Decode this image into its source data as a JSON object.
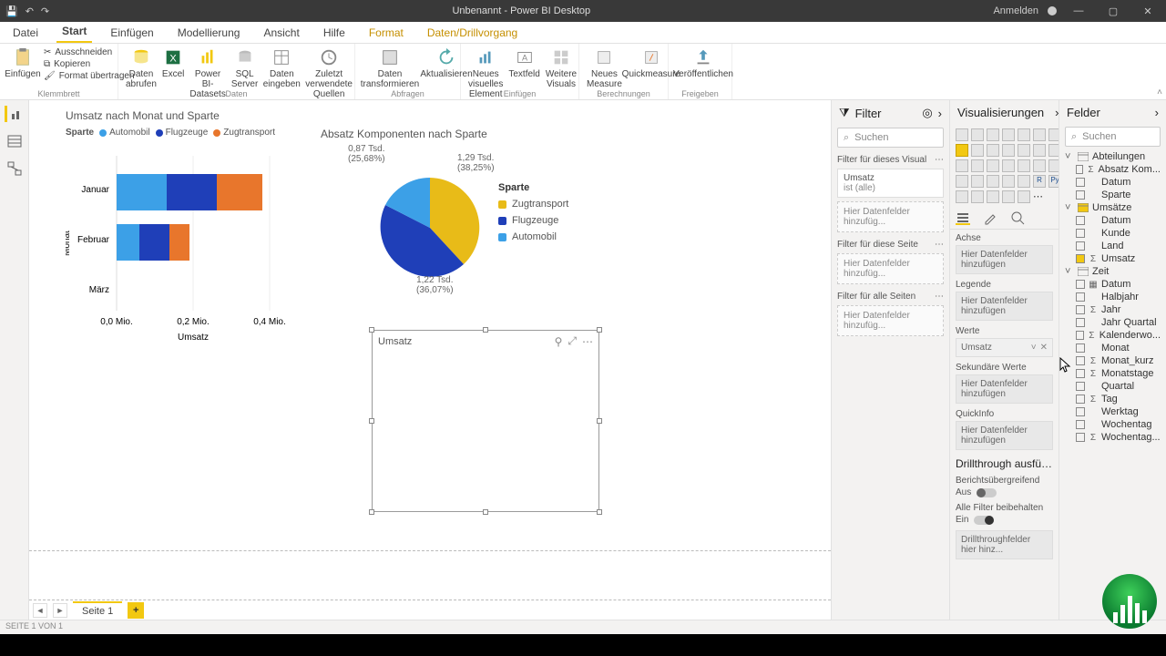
{
  "window": {
    "title": "Unbenannt - Power BI Desktop",
    "signin": "Anmelden"
  },
  "tabs": {
    "file": "Datei",
    "home": "Start",
    "insert": "Einfügen",
    "modeling": "Modellierung",
    "view": "Ansicht",
    "help": "Hilfe",
    "format": "Format",
    "drill": "Daten/Drillvorgang"
  },
  "ribbon": {
    "paste": "Einfügen",
    "cut": "Ausschneiden",
    "copy": "Kopieren",
    "formatpainter": "Format übertragen",
    "clipboard_group": "Klemmbrett",
    "getdata": "Daten abrufen",
    "excel": "Excel",
    "pbids": "Power BI-Datasets",
    "sql": "SQL Server",
    "enterdata": "Daten eingeben",
    "recent": "Zuletzt verwendete Quellen",
    "data_group": "Daten",
    "transform": "Daten transformieren",
    "refresh": "Aktualisieren",
    "queries_group": "Abfragen",
    "newvisual": "Neues visuelles Element",
    "textbox": "Textfeld",
    "morevisuals": "Weitere Visuals",
    "insert_group": "Einfügen",
    "newmeasure": "Neues Measure",
    "quickmeasure": "Quickmeasure",
    "calc_group": "Berechnungen",
    "publish": "Veröffentlichen",
    "share_group": "Freigeben"
  },
  "canvas": {
    "bar_title": "Umsatz nach Monat und Sparte",
    "legend_label": "Sparte",
    "legend_items": [
      "Automobil",
      "Flugzeuge",
      "Zugtransport"
    ],
    "y_title": "Monat",
    "y_cats": [
      "Januar",
      "Februar",
      "März"
    ],
    "x_title": "Umsatz",
    "x_ticks": [
      "0,0 Mio.",
      "0,2 Mio.",
      "0,4 Mio."
    ],
    "pie_title": "Absatz Komponenten nach Sparte",
    "pie_legend_title": "Sparte",
    "pie_legend": [
      "Zugtransport",
      "Flugzeuge",
      "Automobil"
    ],
    "pie_labels": {
      "tl_v": "0,87 Tsd.",
      "tl_p": "(25,68%)",
      "tr_v": "1,29 Tsd.",
      "tr_p": "(38,25%)",
      "b_v": "1,22 Tsd.",
      "b_p": "(36,07%)"
    },
    "placeholder_title": "Umsatz"
  },
  "chart_data": [
    {
      "type": "bar",
      "orientation": "horizontal",
      "stacked": true,
      "title": "Umsatz nach Monat und Sparte",
      "ylabel": "Monat",
      "xlabel": "Umsatz",
      "x_unit": "Mio.",
      "xlim": [
        0,
        0.4
      ],
      "categories": [
        "Januar",
        "Februar",
        "März"
      ],
      "series": [
        {
          "name": "Automobil",
          "color": "#3ca0e7",
          "values": [
            0.12,
            0.05,
            0.0
          ]
        },
        {
          "name": "Flugzeuge",
          "color": "#1f3fb8",
          "values": [
            0.12,
            0.07,
            0.0
          ]
        },
        {
          "name": "Zugtransport",
          "color": "#e8762c",
          "values": [
            0.1,
            0.05,
            0.0
          ]
        }
      ]
    },
    {
      "type": "pie",
      "title": "Absatz Komponenten nach Sparte",
      "unit": "Tsd.",
      "slices": [
        {
          "name": "Zugtransport",
          "value": 1.29,
          "pct": 38.25,
          "color": "#e8bb18"
        },
        {
          "name": "Flugzeuge",
          "value": 1.22,
          "pct": 36.07,
          "color": "#1f3fb8"
        },
        {
          "name": "Automobil",
          "value": 0.87,
          "pct": 25.68,
          "color": "#3ca0e7"
        }
      ]
    }
  ],
  "filter": {
    "header": "Filter",
    "search_ph": "Suchen",
    "visual": "Filter für dieses Visual",
    "card_field": "Umsatz",
    "card_state": "ist (alle)",
    "drop": "Hier Datenfelder hinzufüg...",
    "page": "Filter für diese Seite",
    "all": "Filter für alle Seiten"
  },
  "viz": {
    "header": "Visualisierungen",
    "axis": "Achse",
    "drop": "Hier Datenfelder hinzufügen",
    "legend": "Legende",
    "values": "Werte",
    "value_item": "Umsatz",
    "secondary": "Sekundäre Werte",
    "tooltip": "QuickInfo",
    "drill_header": "Drillthrough ausfü…",
    "cross": "Berichtsübergreifend",
    "off": "Aus",
    "keepall": "Alle Filter beibehalten",
    "on": "Ein",
    "drill_drop": "Drillthroughfelder hier hinz..."
  },
  "fields": {
    "header": "Felder",
    "search_ph": "Suchen",
    "tables": [
      {
        "name": "Abteilungen",
        "expanded": true,
        "fields": [
          {
            "name": "Absatz Kom...",
            "sigma": true
          },
          {
            "name": "Datum"
          },
          {
            "name": "Sparte"
          }
        ]
      },
      {
        "name": "Umsätze",
        "expanded": true,
        "hl": true,
        "fields": [
          {
            "name": "Datum"
          },
          {
            "name": "Kunde"
          },
          {
            "name": "Land"
          },
          {
            "name": "Umsatz",
            "sigma": true,
            "checked": true
          }
        ]
      },
      {
        "name": "Zeit",
        "expanded": true,
        "fields": [
          {
            "name": "Datum",
            "hier": true
          },
          {
            "name": "Halbjahr"
          },
          {
            "name": "Jahr",
            "sigma": true
          },
          {
            "name": "Jahr Quartal"
          },
          {
            "name": "Kalenderwo...",
            "sigma": true
          },
          {
            "name": "Monat"
          },
          {
            "name": "Monat_kurz",
            "sigma": true
          },
          {
            "name": "Monatstage",
            "sigma": true
          },
          {
            "name": "Quartal"
          },
          {
            "name": "Tag",
            "sigma": true
          },
          {
            "name": "Werktag"
          },
          {
            "name": "Wochentag"
          },
          {
            "name": "Wochentag...",
            "sigma": true
          }
        ]
      }
    ]
  },
  "page": {
    "tab": "Seite 1",
    "status": "SEITE 1 VON 1"
  }
}
